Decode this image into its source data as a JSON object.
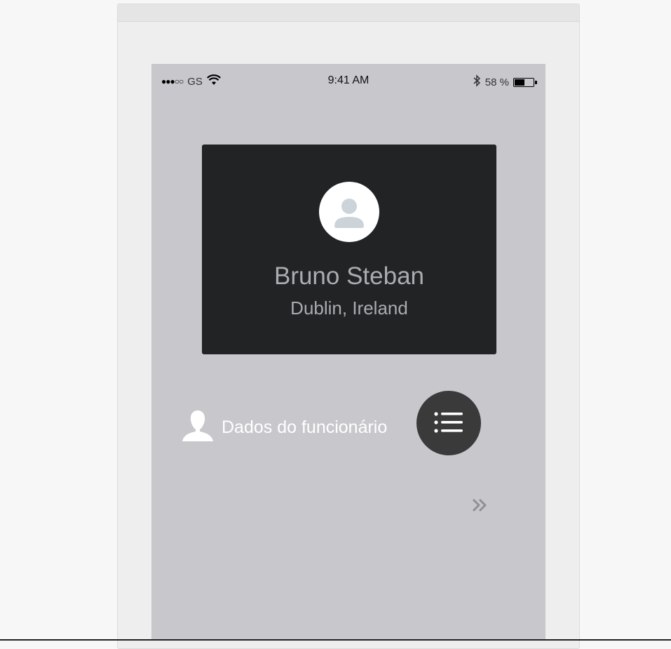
{
  "status_bar": {
    "signal": "●●●○○",
    "carrier": "GS",
    "time": "9:41 AM",
    "battery_percent": "58 %",
    "battery_level": 0.58,
    "icons": [
      "wifi-icon",
      "bluetooth-icon",
      "battery-icon"
    ]
  },
  "profile": {
    "name": "Bruno Steban",
    "location": "Dublin, Ireland",
    "avatar_icon": "user-avatar-icon"
  },
  "employee_section": {
    "label": "Dados do funcionário",
    "icon": "person-silhouette-icon"
  },
  "menu_button": {
    "icon": "list-icon"
  },
  "next_button": {
    "icon": "double-chevron-right-icon"
  },
  "colors": {
    "page_bg": "#f7f7f7",
    "frame_bg": "#eeeeee",
    "phone_bg": "#c8c7cc",
    "card_bg": "#222325",
    "card_text": "#a9adb0",
    "fab_bg": "#3a3a3a",
    "avatar_glyph": "#ccd4d9"
  }
}
